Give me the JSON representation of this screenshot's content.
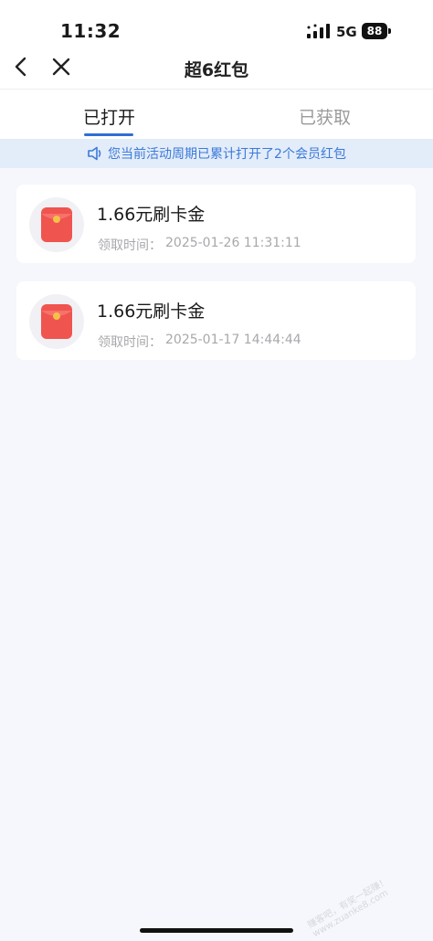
{
  "status_bar": {
    "time": "11:32",
    "network": "5G",
    "battery": "88"
  },
  "nav": {
    "title": "超6红包",
    "back_icon": "chevron-left-icon",
    "close_icon": "close-icon"
  },
  "tabs": [
    {
      "label": "已打开",
      "active": true
    },
    {
      "label": "已获取",
      "active": false
    }
  ],
  "notice": {
    "text": "您当前活动周期已累计打开了2个会员红包",
    "icon": "speaker-icon"
  },
  "records": [
    {
      "title": "1.66元刷卡金",
      "time_label": "领取时间：",
      "time_value": "2025-01-26 11:31:11"
    },
    {
      "title": "1.66元刷卡金",
      "time_label": "领取时间：",
      "time_value": "2025-01-17 14:44:44"
    }
  ],
  "watermark": "赚客吧，有奖一起赚！ www.zuanke8.com",
  "colors": {
    "accent": "#2f6fd6",
    "notice_bg": "#e3ecf9",
    "notice_text": "#3b7ad9",
    "envelope": "#f0544f",
    "page_bg": "#f5f7fc"
  }
}
